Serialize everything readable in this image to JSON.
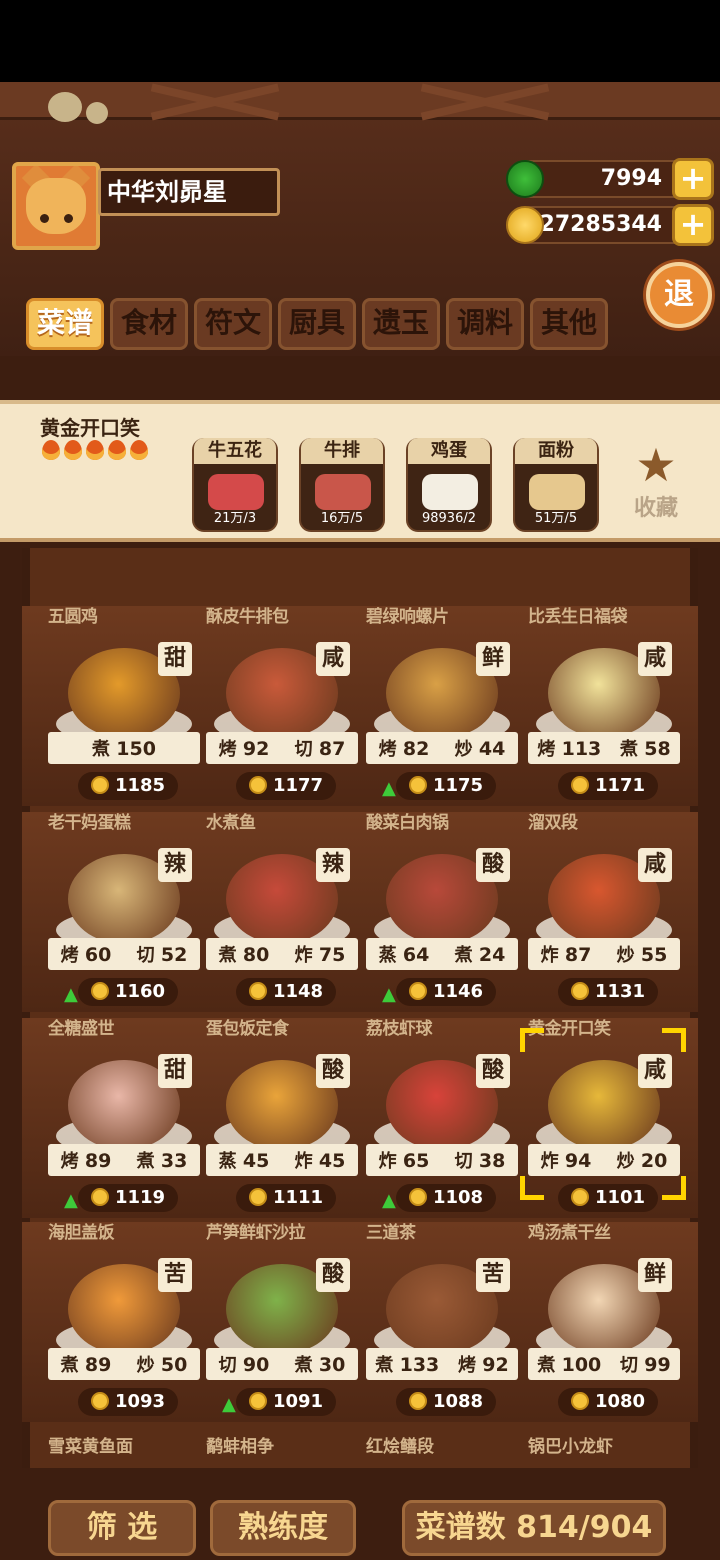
{
  "player": {
    "name": "中华刘昴星"
  },
  "currency": {
    "jade": "7994",
    "coins": "27285344"
  },
  "exit_label": "退",
  "tabs": [
    "菜谱",
    "食材",
    "符文",
    "厨具",
    "遗玉",
    "调料",
    "其他"
  ],
  "detail": {
    "title": "黄金开口笑",
    "flames": 5,
    "ingredients": [
      {
        "name": "牛五花",
        "count": "21万/3",
        "icon": "pork-belly-icon"
      },
      {
        "name": "牛排",
        "count": "16万/5",
        "icon": "steak-icon"
      },
      {
        "name": "鸡蛋",
        "count": "98936/2",
        "icon": "egg-icon"
      },
      {
        "name": "面粉",
        "count": "51万/5",
        "icon": "flour-sack-icon"
      }
    ],
    "favorite_label": "收藏"
  },
  "recipes": [
    {
      "name": "五圆鸡",
      "taste": "甜",
      "m1": "煮",
      "v1": "150",
      "m2": "",
      "v2": "",
      "price": "1185",
      "up": false,
      "color": "#e39a2a"
    },
    {
      "name": "酥皮牛排包",
      "taste": "咸",
      "m1": "烤",
      "v1": "92",
      "m2": "切",
      "v2": "87",
      "price": "1177",
      "up": false,
      "color": "#c95a3a"
    },
    {
      "name": "碧绿响螺片",
      "taste": "鲜",
      "m1": "烤",
      "v1": "82",
      "m2": "炒",
      "v2": "44",
      "price": "1175",
      "up": true,
      "color": "#d9a046"
    },
    {
      "name": "比丢生日福袋",
      "taste": "咸",
      "m1": "烤",
      "v1": "113",
      "m2": "煮",
      "v2": "58",
      "price": "1171",
      "up": false,
      "color": "#f1e29a"
    },
    {
      "name": "老干妈蛋糕",
      "taste": "辣",
      "m1": "烤",
      "v1": "60",
      "m2": "切",
      "v2": "52",
      "price": "1160",
      "up": true,
      "color": "#d8b678"
    },
    {
      "name": "水煮鱼",
      "taste": "辣",
      "m1": "煮",
      "v1": "80",
      "m2": "炸",
      "v2": "75",
      "price": "1148",
      "up": false,
      "color": "#c64a3a"
    },
    {
      "name": "酸菜白肉锅",
      "taste": "酸",
      "m1": "蒸",
      "v1": "64",
      "m2": "煮",
      "v2": "24",
      "price": "1146",
      "up": true,
      "color": "#b8493a"
    },
    {
      "name": "溜双段",
      "taste": "咸",
      "m1": "炸",
      "v1": "87",
      "m2": "炒",
      "v2": "55",
      "price": "1131",
      "up": false,
      "color": "#d8572f"
    },
    {
      "name": "全糖盛世",
      "taste": "甜",
      "m1": "烤",
      "v1": "89",
      "m2": "煮",
      "v2": "33",
      "price": "1119",
      "up": true,
      "color": "#e9b7a8"
    },
    {
      "name": "蛋包饭定食",
      "taste": "酸",
      "m1": "蒸",
      "v1": "45",
      "m2": "炸",
      "v2": "45",
      "price": "1111",
      "up": false,
      "color": "#e9a43a"
    },
    {
      "name": "荔枝虾球",
      "taste": "酸",
      "m1": "炸",
      "v1": "65",
      "m2": "切",
      "v2": "38",
      "price": "1108",
      "up": true,
      "color": "#d8433a"
    },
    {
      "name": "黄金开口笑",
      "taste": "咸",
      "m1": "炸",
      "v1": "94",
      "m2": "炒",
      "v2": "20",
      "price": "1101",
      "up": false,
      "color": "#e6b83a"
    },
    {
      "name": "海胆盖饭",
      "taste": "苦",
      "m1": "煮",
      "v1": "89",
      "m2": "炒",
      "v2": "50",
      "price": "1093",
      "up": false,
      "color": "#f09a3a"
    },
    {
      "name": "芦笋鲜虾沙拉",
      "taste": "酸",
      "m1": "切",
      "v1": "90",
      "m2": "煮",
      "v2": "30",
      "price": "1091",
      "up": true,
      "color": "#7fb24a"
    },
    {
      "name": "三道茶",
      "taste": "苦",
      "m1": "煮",
      "v1": "133",
      "m2": "烤",
      "v2": "92",
      "price": "1088",
      "up": false,
      "color": "#9a5a36"
    },
    {
      "name": "鸡汤煮干丝",
      "taste": "鲜",
      "m1": "煮",
      "v1": "100",
      "m2": "切",
      "v2": "99",
      "price": "1080",
      "up": false,
      "color": "#f2d6b4"
    }
  ],
  "next_row": [
    "雪菜黄鱼面",
    "鹬蚌相争",
    "红烩鳝段",
    "锅巴小龙虾"
  ],
  "footer": {
    "filter": "筛 选",
    "mastery": "熟练度",
    "count": "菜谱数 814/904"
  }
}
